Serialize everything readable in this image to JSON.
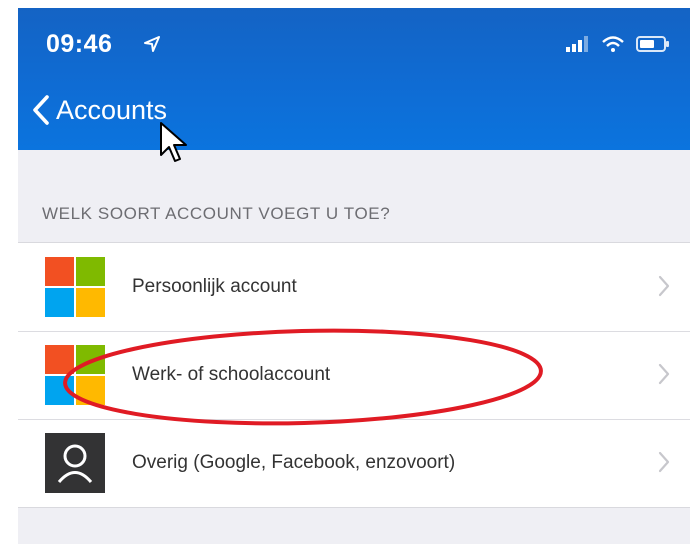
{
  "status_bar": {
    "time": "09:46"
  },
  "nav": {
    "back_label": "Accounts"
  },
  "section_header": "WELK SOORT ACCOUNT VOEGT U TOE?",
  "accounts": [
    {
      "label": "Persoonlijk account",
      "icon": "microsoft-logo-icon"
    },
    {
      "label": "Werk- of schoolaccount",
      "icon": "microsoft-logo-icon",
      "highlighted": true
    },
    {
      "label": "Overig (Google, Facebook, enzovoort)",
      "icon": "person-icon"
    }
  ],
  "colors": {
    "header_blue": "#0f6cd4",
    "highlight_ellipse": "#e01b24",
    "ms_red": "#f25022",
    "ms_green": "#7fba00",
    "ms_blue": "#00a4ef",
    "ms_yellow": "#ffb900"
  }
}
